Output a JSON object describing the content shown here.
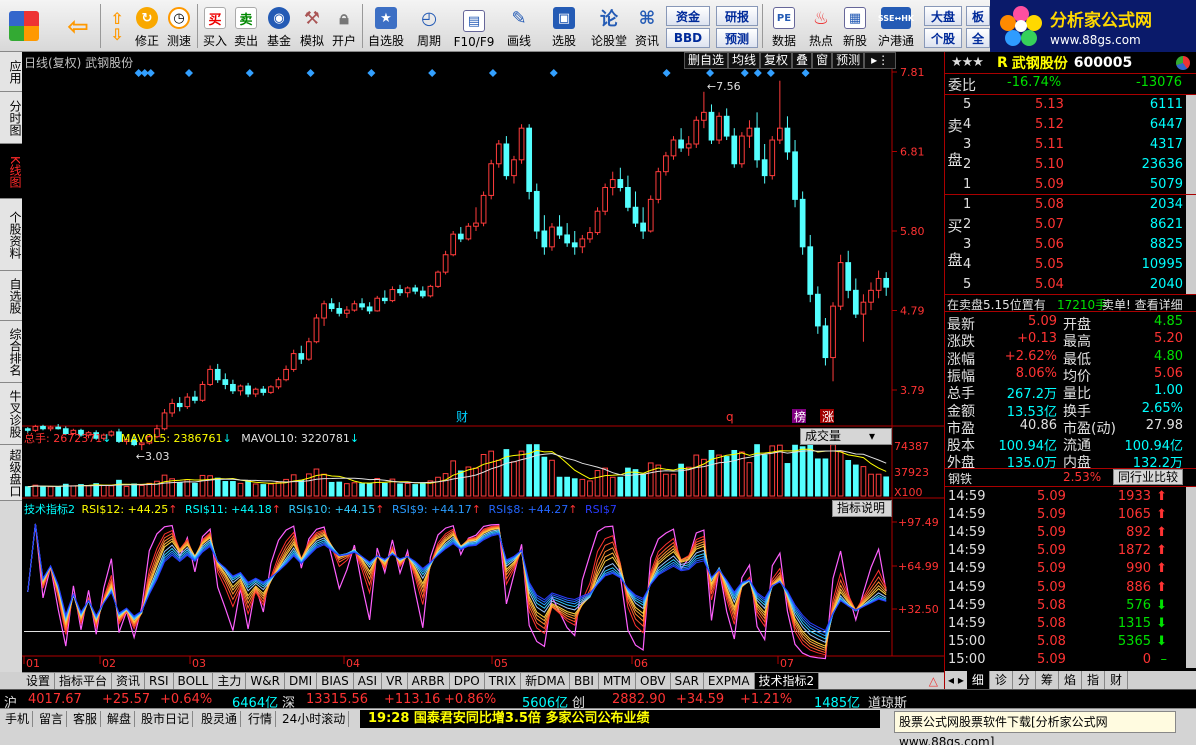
{
  "toolbar": {
    "buttons": [
      "修正",
      "测速",
      "买入",
      "卖出",
      "基金",
      "模拟",
      "开户",
      "自选股",
      "周期",
      "F10/F9",
      "画线",
      "选股",
      "论股堂",
      "资讯",
      "数据",
      "热点",
      "新股",
      "沪港通"
    ],
    "small": {
      "fund": "资金",
      "bbd": "BBD",
      "research": "研报",
      "forecast": "预测",
      "dapan": "大盘",
      "stock": "个股",
      "ban": "板",
      "quan": "全"
    },
    "logo": {
      "title": "分析家公式网",
      "url": "www.88gs.com"
    }
  },
  "left_tabs": [
    "应用",
    "分时图",
    "K线图",
    "个股资料",
    "自选股",
    "综合排名",
    "牛叉诊股",
    "超级盘口"
  ],
  "chart": {
    "title": "日线(复权) 武钢股份",
    "buttons": [
      "删自选",
      "均线",
      "复权",
      "叠",
      "窗",
      "预测"
    ],
    "price_ticks": [
      "7.81",
      "6.81",
      "5.80",
      "4.79",
      "3.79"
    ],
    "high_marker": "7.56",
    "low_marker": "3.03",
    "event_marks": {
      "cai": "财",
      "q": "q",
      "bang": "榜",
      "zhang": "涨"
    },
    "volume_label": {
      "total": "总手: 2672371",
      "ma5": "MAVOL5: 2386761",
      "ma10": "MAVOL10: 3220781"
    },
    "volume_ticks": [
      "74387",
      "37923",
      "X100"
    ],
    "volume_btn": "成交量",
    "rsi_label": {
      "name": "技术指标2",
      "r12": "RSI$12: +44.25",
      "r11": "RSI$11: +44.18",
      "r10": "RSI$10: +44.15",
      "r9": "RSI$9: +44.17",
      "r8": "RSI$8: +44.27",
      "r7": "RSI$7"
    },
    "rsi_btn": "指标说明",
    "rsi_ticks": [
      "+97.49",
      "+64.99",
      "+32.50"
    ],
    "month_labels": [
      "01",
      "02",
      "03",
      "04",
      "05",
      "06",
      "07"
    ]
  },
  "chart_data": {
    "type": "candlestick",
    "title": "日线(复权) 武钢股份",
    "ylim": [
      3.0,
      7.81
    ],
    "y_ticks": [
      7.81,
      6.81,
      5.8,
      4.79,
      3.79
    ],
    "candles": [
      [
        3.3,
        3.32,
        3.25,
        3.28
      ],
      [
        3.28,
        3.35,
        3.26,
        3.33
      ],
      [
        3.33,
        3.35,
        3.28,
        3.3
      ],
      [
        3.3,
        3.34,
        3.27,
        3.32
      ],
      [
        3.32,
        3.36,
        3.29,
        3.3
      ],
      [
        3.3,
        3.33,
        3.22,
        3.24
      ],
      [
        3.24,
        3.3,
        3.22,
        3.28
      ],
      [
        3.28,
        3.3,
        3.2,
        3.22
      ],
      [
        3.22,
        3.27,
        3.18,
        3.25
      ],
      [
        3.25,
        3.28,
        3.16,
        3.18
      ],
      [
        3.18,
        3.24,
        3.15,
        3.22
      ],
      [
        3.22,
        3.28,
        3.2,
        3.26
      ],
      [
        3.26,
        3.3,
        3.12,
        3.14
      ],
      [
        3.14,
        3.18,
        3.1,
        3.16
      ],
      [
        3.16,
        3.2,
        3.08,
        3.1
      ],
      [
        3.1,
        3.14,
        3.03,
        3.12
      ],
      [
        3.12,
        3.22,
        3.1,
        3.2
      ],
      [
        3.2,
        3.35,
        3.18,
        3.3
      ],
      [
        3.3,
        3.55,
        3.28,
        3.5
      ],
      [
        3.5,
        3.68,
        3.45,
        3.62
      ],
      [
        3.62,
        3.7,
        3.52,
        3.58
      ],
      [
        3.58,
        3.75,
        3.55,
        3.7
      ],
      [
        3.7,
        3.78,
        3.62,
        3.66
      ],
      [
        3.66,
        3.9,
        3.64,
        3.86
      ],
      [
        3.86,
        4.1,
        3.84,
        4.05
      ],
      [
        4.05,
        4.12,
        3.88,
        3.92
      ],
      [
        3.92,
        4.0,
        3.8,
        3.86
      ],
      [
        3.86,
        3.92,
        3.74,
        3.78
      ],
      [
        3.78,
        3.86,
        3.72,
        3.84
      ],
      [
        3.84,
        3.88,
        3.7,
        3.74
      ],
      [
        3.74,
        3.82,
        3.7,
        3.8
      ],
      [
        3.8,
        3.84,
        3.72,
        3.76
      ],
      [
        3.76,
        3.85,
        3.74,
        3.83
      ],
      [
        3.83,
        3.95,
        3.8,
        3.92
      ],
      [
        3.92,
        4.1,
        3.9,
        4.05
      ],
      [
        4.05,
        4.3,
        4.02,
        4.25
      ],
      [
        4.25,
        4.35,
        4.12,
        4.18
      ],
      [
        4.18,
        4.45,
        4.16,
        4.4
      ],
      [
        4.4,
        4.75,
        4.38,
        4.7
      ],
      [
        4.7,
        4.92,
        4.6,
        4.88
      ],
      [
        4.88,
        4.95,
        4.78,
        4.82
      ],
      [
        4.82,
        4.9,
        4.72,
        4.76
      ],
      [
        4.76,
        4.85,
        4.7,
        4.8
      ],
      [
        4.8,
        4.92,
        4.78,
        4.88
      ],
      [
        4.88,
        4.95,
        4.8,
        4.84
      ],
      [
        4.84,
        4.9,
        4.75,
        4.79
      ],
      [
        4.79,
        4.98,
        4.78,
        4.95
      ],
      [
        4.95,
        5.05,
        4.88,
        4.92
      ],
      [
        4.92,
        5.1,
        4.9,
        5.06
      ],
      [
        5.06,
        5.12,
        4.98,
        5.02
      ],
      [
        5.02,
        5.1,
        4.96,
        5.08
      ],
      [
        5.08,
        5.12,
        5.0,
        5.04
      ],
      [
        5.04,
        5.1,
        4.95,
        4.98
      ],
      [
        4.98,
        5.12,
        4.96,
        5.1
      ],
      [
        5.1,
        5.3,
        5.08,
        5.28
      ],
      [
        5.28,
        5.55,
        5.25,
        5.5
      ],
      [
        5.5,
        5.8,
        5.48,
        5.76
      ],
      [
        5.76,
        5.85,
        5.66,
        5.7
      ],
      [
        5.7,
        5.9,
        5.68,
        5.86
      ],
      [
        5.86,
        6.1,
        5.8,
        5.9
      ],
      [
        5.9,
        6.3,
        5.86,
        6.25
      ],
      [
        6.25,
        6.7,
        6.2,
        6.65
      ],
      [
        6.65,
        6.95,
        6.6,
        6.9
      ],
      [
        6.9,
        7.0,
        6.45,
        6.5
      ],
      [
        6.5,
        6.75,
        6.4,
        6.7
      ],
      [
        6.7,
        7.15,
        6.65,
        7.1
      ],
      [
        7.1,
        7.15,
        6.2,
        6.3
      ],
      [
        6.3,
        6.4,
        5.7,
        5.8
      ],
      [
        5.8,
        6.0,
        5.5,
        5.6
      ],
      [
        5.6,
        5.9,
        5.55,
        5.85
      ],
      [
        5.85,
        6.0,
        5.7,
        5.75
      ],
      [
        5.75,
        5.9,
        5.6,
        5.65
      ],
      [
        5.65,
        5.8,
        5.5,
        5.6
      ],
      [
        5.6,
        5.75,
        5.52,
        5.7
      ],
      [
        5.7,
        5.85,
        5.65,
        5.78
      ],
      [
        5.78,
        6.1,
        5.75,
        6.05
      ],
      [
        6.05,
        6.4,
        6.0,
        6.35
      ],
      [
        6.35,
        6.55,
        6.25,
        6.45
      ],
      [
        6.45,
        6.6,
        6.3,
        6.35
      ],
      [
        6.35,
        6.5,
        6.05,
        6.1
      ],
      [
        6.1,
        6.3,
        5.85,
        5.9
      ],
      [
        5.9,
        6.1,
        5.7,
        5.8
      ],
      [
        5.8,
        6.25,
        5.78,
        6.2
      ],
      [
        6.2,
        6.6,
        6.15,
        6.55
      ],
      [
        6.55,
        6.8,
        6.5,
        6.75
      ],
      [
        6.75,
        7.0,
        6.7,
        6.95
      ],
      [
        6.95,
        7.1,
        6.8,
        6.85
      ],
      [
        6.85,
        7.0,
        6.75,
        6.9
      ],
      [
        6.9,
        7.25,
        6.85,
        7.2
      ],
      [
        7.2,
        7.56,
        7.1,
        7.3
      ],
      [
        7.3,
        7.4,
        6.9,
        6.95
      ],
      [
        6.95,
        7.3,
        6.9,
        7.25
      ],
      [
        7.25,
        7.35,
        6.95,
        7.0
      ],
      [
        7.0,
        7.1,
        6.6,
        6.65
      ],
      [
        6.65,
        7.05,
        6.6,
        7.0
      ],
      [
        7.0,
        7.2,
        6.85,
        7.1
      ],
      [
        7.1,
        7.3,
        6.6,
        6.7
      ],
      [
        6.7,
        6.9,
        6.4,
        6.5
      ],
      [
        6.5,
        7.0,
        6.45,
        6.95
      ],
      [
        6.95,
        7.7,
        6.9,
        7.1
      ],
      [
        7.1,
        7.25,
        6.7,
        6.8
      ],
      [
        6.8,
        6.95,
        6.1,
        6.2
      ],
      [
        6.2,
        6.3,
        5.5,
        5.6
      ],
      [
        5.6,
        5.75,
        4.9,
        5.0
      ],
      [
        5.0,
        5.1,
        4.5,
        4.6
      ],
      [
        4.6,
        4.7,
        4.1,
        4.2
      ],
      [
        4.2,
        4.9,
        3.9,
        4.85
      ],
      [
        4.85,
        5.5,
        4.8,
        5.4
      ],
      [
        5.4,
        5.55,
        4.95,
        5.05
      ],
      [
        5.05,
        5.2,
        4.7,
        4.75
      ],
      [
        4.75,
        5.0,
        4.4,
        4.9
      ],
      [
        4.9,
        5.15,
        4.8,
        5.05
      ],
      [
        5.05,
        5.3,
        4.95,
        5.2
      ],
      [
        5.2,
        5.28,
        4.98,
        5.09
      ]
    ],
    "volume": {
      "total": 2672371,
      "mavol5": 2386761,
      "mavol10": 3220781,
      "ylim": [
        0,
        74387
      ],
      "y_ticks": [
        74387,
        37923
      ]
    },
    "rsi": {
      "series": [
        {
          "name": "RSI$12",
          "value": 44.25
        },
        {
          "name": "RSI$11",
          "value": 44.18
        },
        {
          "name": "RSI$10",
          "value": 44.15
        },
        {
          "name": "RSI$9",
          "value": 44.17
        },
        {
          "name": "RSI$8",
          "value": 44.27
        },
        {
          "name": "RSI$7"
        }
      ],
      "y_ticks": [
        97.49,
        64.99,
        32.5
      ]
    },
    "x_labels": [
      "01",
      "02",
      "03",
      "04",
      "05",
      "06",
      "07"
    ]
  },
  "indicator_tabs": [
    "设置",
    "指标平台",
    "资讯",
    "RSI",
    "BOLL",
    "主力",
    "W&R",
    "DMI",
    "BIAS",
    "ASI",
    "VR",
    "ARBR",
    "DPO",
    "TRIX",
    "新DMA",
    "BBI",
    "MTM",
    "OBV",
    "SAR",
    "EXPMA",
    "技术指标2"
  ],
  "quote": {
    "prefix": "R",
    "name": "武钢股份",
    "code": "600005",
    "weibi": {
      "label": "委比",
      "pct": "-16.74%",
      "diff": "-13076"
    },
    "sell_label": [
      "卖",
      "盘"
    ],
    "buy_label": [
      "买",
      "盘"
    ],
    "sell": [
      [
        "5",
        "5.13",
        "6111"
      ],
      [
        "4",
        "5.12",
        "6447"
      ],
      [
        "3",
        "5.11",
        "4317"
      ],
      [
        "2",
        "5.10",
        "23636"
      ],
      [
        "1",
        "5.09",
        "5079"
      ]
    ],
    "buy": [
      [
        "1",
        "5.08",
        "2034"
      ],
      [
        "2",
        "5.07",
        "8621"
      ],
      [
        "3",
        "5.06",
        "8825"
      ],
      [
        "4",
        "5.05",
        "10995"
      ],
      [
        "5",
        "5.04",
        "2040"
      ]
    ],
    "notice": {
      "text": "在卖盘5.15位置有",
      "qty": "17210手",
      "tail": "卖单! 查看详细"
    },
    "stats": [
      [
        "最新",
        "5.09",
        "开盘",
        "4.85"
      ],
      [
        "涨跌",
        "+0.13",
        "最高",
        "5.20"
      ],
      [
        "涨幅",
        "+2.62%",
        "最低",
        "4.80"
      ],
      [
        "振幅",
        "8.06%",
        "均价",
        "5.06"
      ],
      [
        "总手",
        "267.2万",
        "量比",
        "1.00"
      ],
      [
        "金额",
        "13.53亿",
        "换手",
        "2.65%"
      ],
      [
        "市盈",
        "40.86",
        "市盈(动)",
        "27.98"
      ],
      [
        "股本",
        "100.94亿",
        "流通",
        "100.94亿"
      ],
      [
        "外盘",
        "135.0万",
        "内盘",
        "132.2万"
      ]
    ],
    "industry": {
      "name": "钢铁",
      "pct": "2.53%",
      "btn": "同行业比较"
    },
    "ticks": [
      [
        "14:59",
        "5.09",
        "1933",
        "up"
      ],
      [
        "14:59",
        "5.09",
        "1065",
        "up"
      ],
      [
        "14:59",
        "5.09",
        "892",
        "up"
      ],
      [
        "14:59",
        "5.09",
        "1872",
        "up"
      ],
      [
        "14:59",
        "5.09",
        "990",
        "up"
      ],
      [
        "14:59",
        "5.09",
        "886",
        "up"
      ],
      [
        "14:59",
        "5.08",
        "576",
        "down"
      ],
      [
        "14:59",
        "5.08",
        "1315",
        "down"
      ],
      [
        "15:00",
        "5.08",
        "5365",
        "down"
      ],
      [
        "15:00",
        "5.09",
        "0",
        "none"
      ]
    ],
    "bottom_tabs": [
      "细",
      "诊",
      "分",
      "筹",
      "焰",
      "指",
      "财"
    ]
  },
  "status": {
    "sh": {
      "label": "沪",
      "index": "4017.67",
      "chg": "+25.57",
      "pct": "+0.64%",
      "amount": "6464亿"
    },
    "sz": {
      "label": "深",
      "index": "13315.56",
      "chg": "+113.16",
      "pct": "+0.86%",
      "amount": "5606亿"
    },
    "cy": {
      "label": "创",
      "index": "2882.90",
      "chg": "+34.59",
      "pct": "+1.21%",
      "amount": "1485亿"
    },
    "daoqiong": "道琼斯",
    "buttons": [
      "手机",
      "留言",
      "客服",
      "解盘",
      "股市日记",
      "股灵通",
      "行情",
      "24小时滚动"
    ],
    "news": "19:28 国泰君安同比增3.5倍 多家公司公布业绩",
    "ad": "股票公式网股票软件下载[分析家公式网www.88gs.com]"
  }
}
